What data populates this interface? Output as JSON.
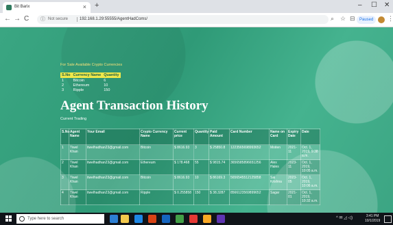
{
  "browser": {
    "tab_title": "Bit Barix",
    "tab_close": "×",
    "new_tab": "+",
    "win_min": "–",
    "win_max": "☐",
    "win_close": "✕",
    "back": "←",
    "forward": "→",
    "reload": "C",
    "security": "Not secure",
    "url": "192.168.1.29:55555/AgentHadComs/",
    "paused": "Paused",
    "menu": "⋮"
  },
  "page": {
    "sale_title": "For Sale Available Crypto Currencies",
    "sale_headers": [
      "S.No",
      "Currency Name",
      "Quantity"
    ],
    "sale_rows": [
      [
        "1",
        "Bitcoin",
        "6"
      ],
      [
        "2",
        "Ethereum",
        "10"
      ],
      [
        "3",
        "Ripple",
        "150"
      ]
    ],
    "main_title": "Agent Transaction History",
    "sub_title": "Current Trading",
    "tx_headers": [
      "S.No",
      "Agent Name",
      "Your Email",
      "Crypto Currency Name",
      "Current price",
      "Quantity",
      "Paid Amount",
      "Card Number",
      "Name on Card",
      "Expiry Date",
      "Date"
    ],
    "tx_rows": [
      [
        "1",
        "Tiwel Khan",
        "tiwelhadhan23@gmail.com",
        "Bitcoin",
        "$ 8616.93",
        "3",
        "$ 25850.8",
        "1223565698993652",
        "Moiten",
        "2021-11",
        "Oct. 1, 2019, 9:38 a.m."
      ],
      [
        "2",
        "Tiwel Khan",
        "tiwelhadhan23@gmail.com",
        "Ethereum",
        "$ 178.468",
        "55",
        "$ 9815.74",
        "3656585896651256",
        "Alex Hales",
        "2023-11",
        "Oct. 1, 2019, 10:05 a.m."
      ],
      [
        "3",
        "Tiwel Khan",
        "tiwelhadhan23@gmail.com",
        "Bitcoin",
        "$ 8616.93",
        "10",
        "$ 86169.3",
        "5656545512125858",
        "Sai Krishna",
        "2023-05",
        "Oct. 1, 2019, 10:06 a.m."
      ],
      [
        "4",
        "Tiwel Khan",
        "tiwelhadhan23@gmail.com",
        "Ripple",
        "$ 0.255858",
        "150",
        "$ 38.3287",
        "8566123569899652",
        "Sagar",
        "2021-01",
        "Oct. 1, 2019, 10:32 a.m."
      ]
    ]
  },
  "taskbar": {
    "search_placeholder": "Type here to search",
    "tray_icons": "^ ✉ ◿ ◁)",
    "time": "3:41 PM",
    "date": "10/1/2019",
    "icon_colors": [
      "#2d7fd3",
      "#f2c94c",
      "#1e88e5",
      "#d84315",
      "#1565c0",
      "#43a047",
      "#e53935",
      "#f9a825",
      "#5e35b1"
    ]
  }
}
